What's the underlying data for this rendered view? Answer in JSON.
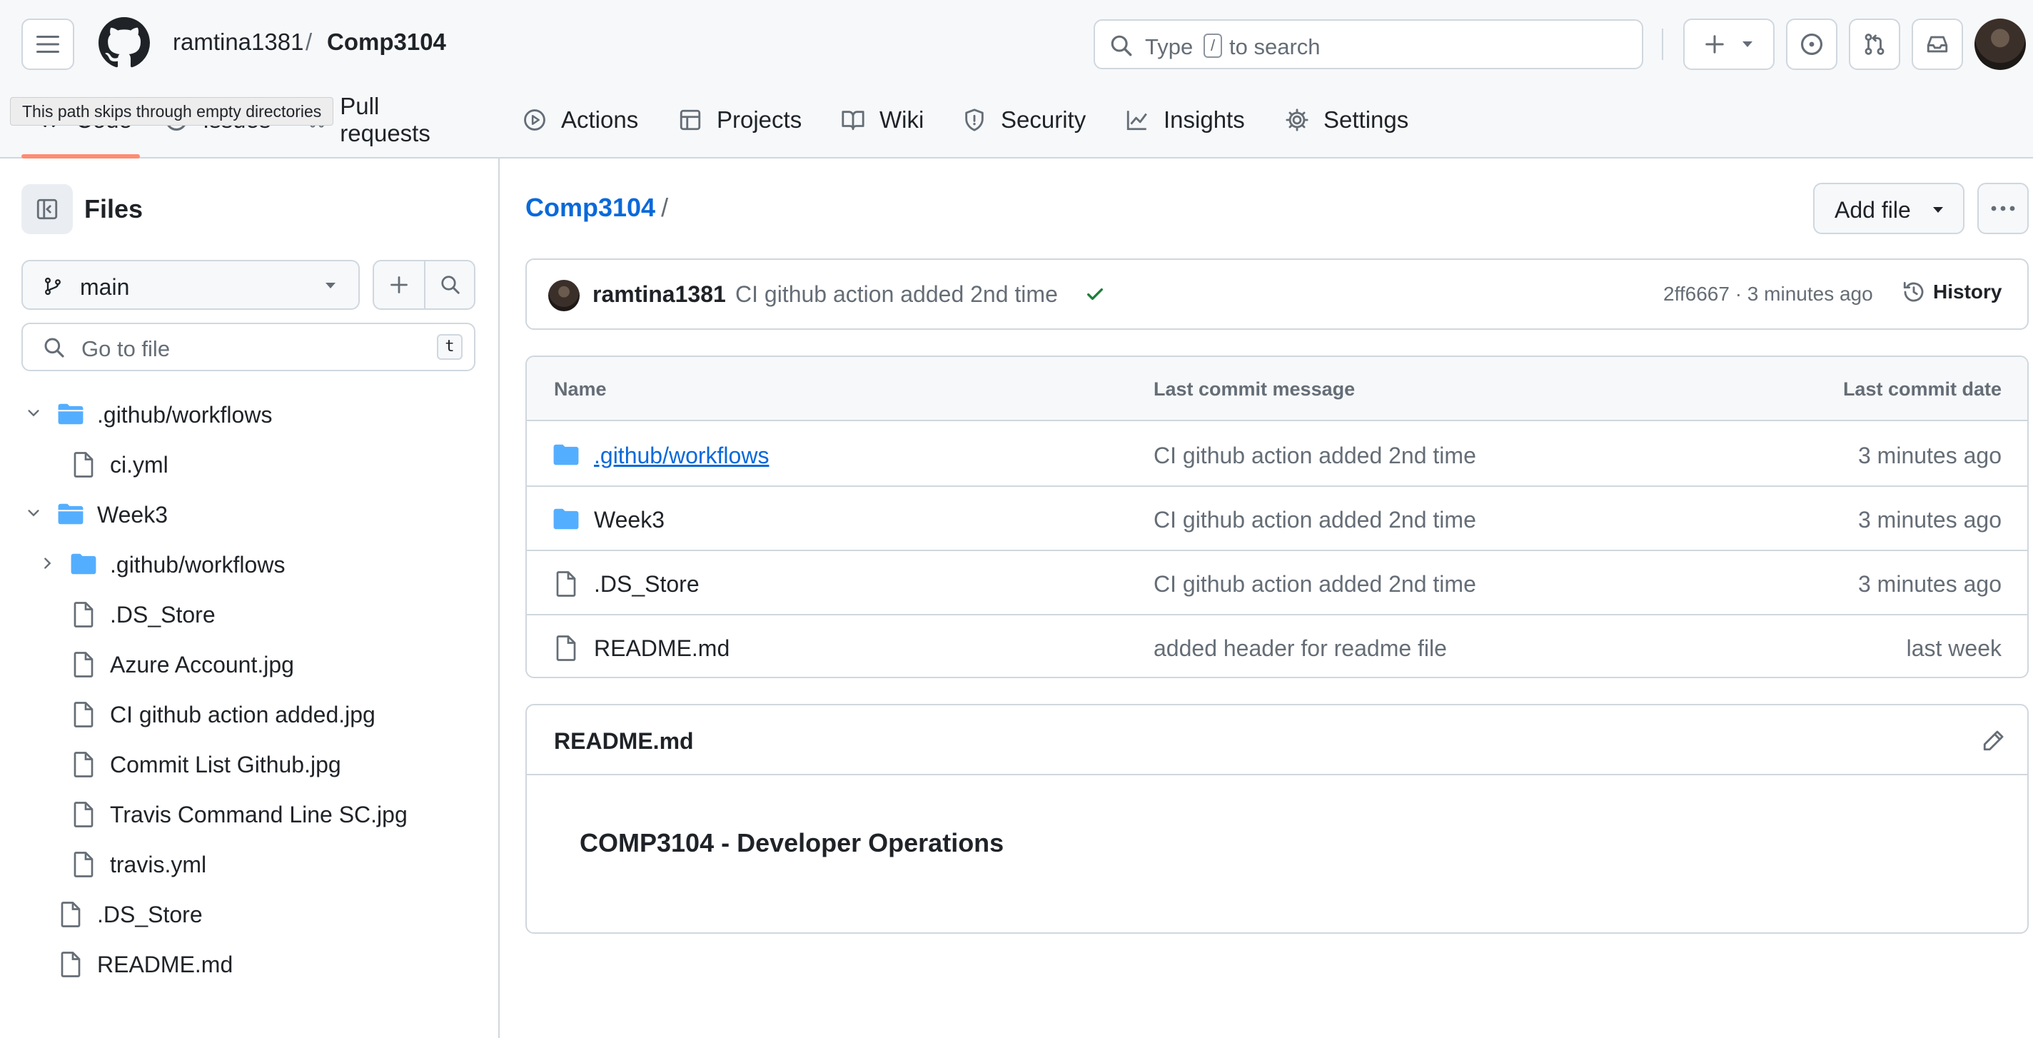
{
  "header": {
    "repo_owner": "ramtina1381",
    "repo_separator": "/",
    "repo_name": "Comp3104",
    "search": {
      "prefix": "Type",
      "key": "/",
      "suffix": "to search"
    }
  },
  "tooltip": "This path skips through empty directories",
  "nav": {
    "items": [
      {
        "label": "Code",
        "icon": "code-icon"
      },
      {
        "label": "Issues",
        "icon": "issue-icon"
      },
      {
        "label": "Pull requests",
        "icon": "pull-request-icon"
      },
      {
        "label": "Actions",
        "icon": "play-icon"
      },
      {
        "label": "Projects",
        "icon": "table-icon"
      },
      {
        "label": "Wiki",
        "icon": "book-icon"
      },
      {
        "label": "Security",
        "icon": "shield-icon"
      },
      {
        "label": "Insights",
        "icon": "graph-icon"
      },
      {
        "label": "Settings",
        "icon": "gear-icon"
      }
    ],
    "active": "Code"
  },
  "sidebar": {
    "title": "Files",
    "branch": "main",
    "goto_placeholder": "Go to file",
    "goto_shortcut": "t",
    "tree": [
      {
        "label": ".github/workflows",
        "type": "folder",
        "expanded": true
      },
      {
        "label": "ci.yml",
        "type": "file"
      },
      {
        "label": "Week3",
        "type": "folder",
        "expanded": true
      },
      {
        "label": ".github/workflows",
        "type": "folder",
        "expanded": false
      },
      {
        "label": ".DS_Store",
        "type": "file"
      },
      {
        "label": "Azure Account.jpg",
        "type": "file"
      },
      {
        "label": "CI github action added.jpg",
        "type": "file"
      },
      {
        "label": "Commit List Github.jpg",
        "type": "file"
      },
      {
        "label": "Travis Command Line SC.jpg",
        "type": "file"
      },
      {
        "label": "travis.yml",
        "type": "file"
      },
      {
        "label": ".DS_Store",
        "type": "file"
      },
      {
        "label": "README.md",
        "type": "file"
      }
    ]
  },
  "main": {
    "breadcrumb_root": "Comp3104",
    "breadcrumb_sep": "/",
    "add_file_label": "Add file",
    "commit": {
      "author": "ramtina1381",
      "message": "CI github action added 2nd time",
      "meta": "2ff6667 · 3 minutes ago",
      "history_label": "History"
    },
    "table": {
      "headers": [
        "Name",
        "Last commit message",
        "Last commit date"
      ],
      "rows": [
        {
          "name": ".github/workflows",
          "type": "folder",
          "message": "CI github action added 2nd time",
          "date": "3 minutes ago"
        },
        {
          "name": "Week3",
          "type": "folder",
          "message": "CI github action added 2nd time",
          "date": "3 minutes ago"
        },
        {
          "name": ".DS_Store",
          "type": "file",
          "message": "CI github action added 2nd time",
          "date": "3 minutes ago"
        },
        {
          "name": "README.md",
          "type": "file",
          "message": "added header for readme file",
          "date": "last week"
        }
      ]
    },
    "readme": {
      "title": "README.md",
      "heading": "COMP3104 - Developer Operations"
    }
  },
  "colors": {
    "accent_link": "#0969da",
    "folder": "#54aeff",
    "success": "#1a7f37",
    "nav_underline": "#fd8c73"
  }
}
